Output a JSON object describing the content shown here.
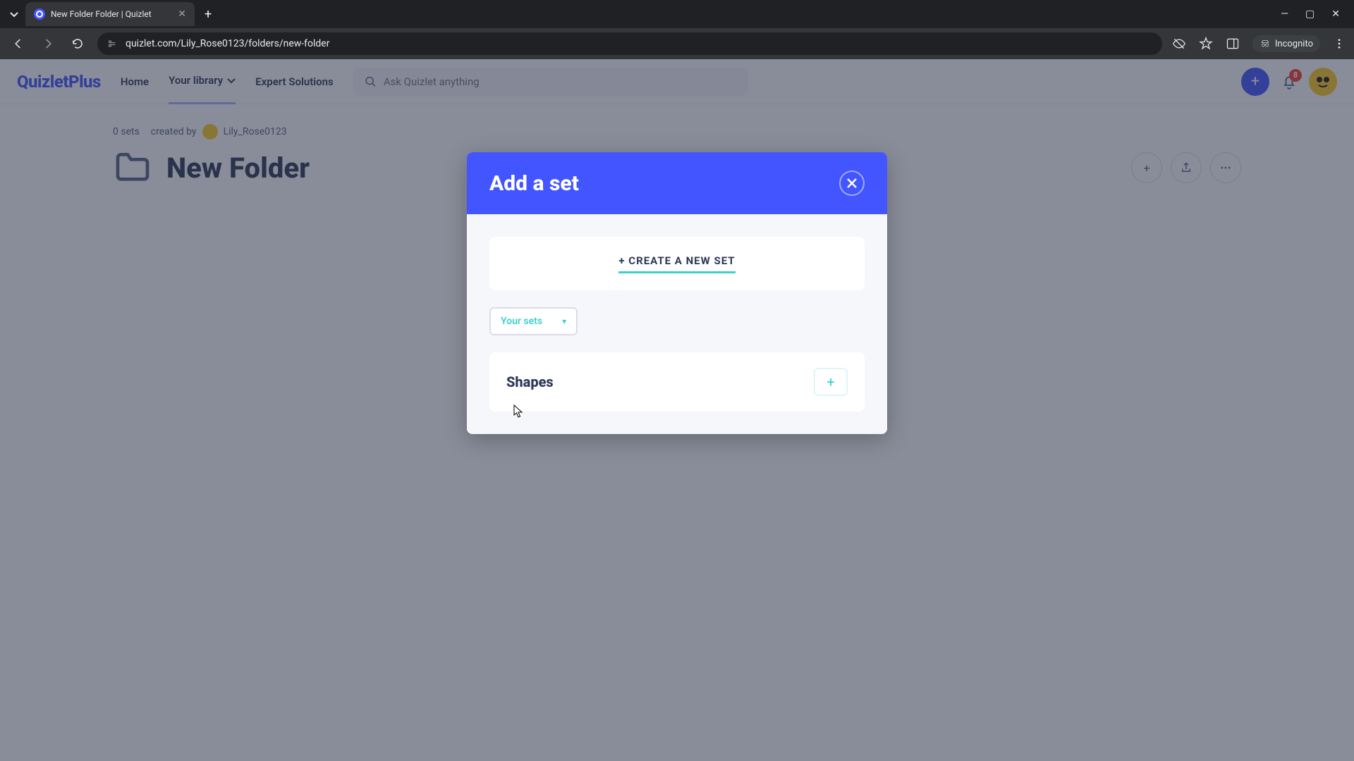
{
  "browser": {
    "tab_title": "New Folder Folder | Quizlet",
    "url": "quizlet.com/Lily_Rose0123/folders/new-folder",
    "incognito_label": "Incognito"
  },
  "header": {
    "logo": "QuizletPlus",
    "nav": {
      "home": "Home",
      "library": "Your library",
      "expert": "Expert Solutions"
    },
    "search_placeholder": "Ask Quizlet anything",
    "notification_count": "8"
  },
  "folder": {
    "set_count": "0 sets",
    "created_by_label": "created by",
    "creator": "Lily_Rose0123",
    "title": "New Folder"
  },
  "modal": {
    "title": "Add a set",
    "create_label": "+ CREATE A NEW SET",
    "dropdown_label": "Your sets",
    "sets": [
      {
        "name": "Shapes"
      }
    ]
  }
}
